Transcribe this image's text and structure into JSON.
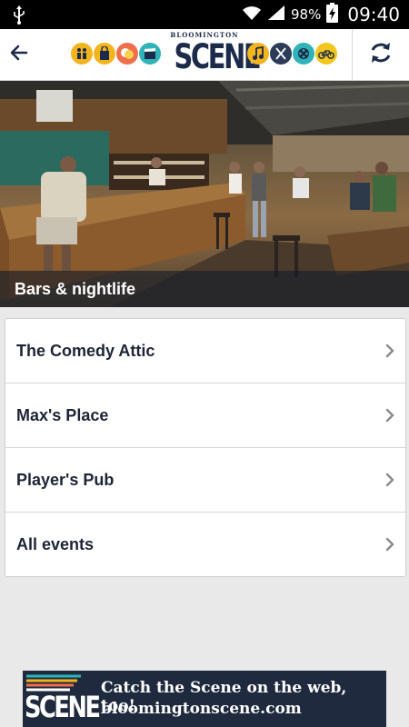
{
  "status_bar": {
    "battery_percent": "98%",
    "time": "09:40"
  },
  "header": {
    "logo_small": "BLOOMINGTON",
    "logo_big": "SCENE",
    "category_icons": [
      {
        "name": "family-icon",
        "color": "#f2b51f"
      },
      {
        "name": "shopping-icon",
        "color": "#f2b51f"
      },
      {
        "name": "theater-masks-icon",
        "color": "#ef6e4b"
      },
      {
        "name": "film-clapper-icon",
        "color": "#2fb3b8"
      },
      {
        "name": "music-note-icon",
        "color": "#f2b51f"
      },
      {
        "name": "dining-icon",
        "color": "#2b3b58"
      },
      {
        "name": "film-reel-icon",
        "color": "#2fb3b8"
      },
      {
        "name": "bicycle-icon",
        "color": "#f2c61f"
      }
    ]
  },
  "hero": {
    "caption": "Bars & nightlife"
  },
  "list": {
    "items": [
      {
        "label": "The Comedy Attic"
      },
      {
        "label": "Max's Place"
      },
      {
        "label": "Player's Pub"
      },
      {
        "label": "All events"
      }
    ]
  },
  "banner": {
    "logo": "SCENE",
    "line1": "Catch the Scene on the web, too!",
    "line2": "bloomingtonscene.com"
  }
}
